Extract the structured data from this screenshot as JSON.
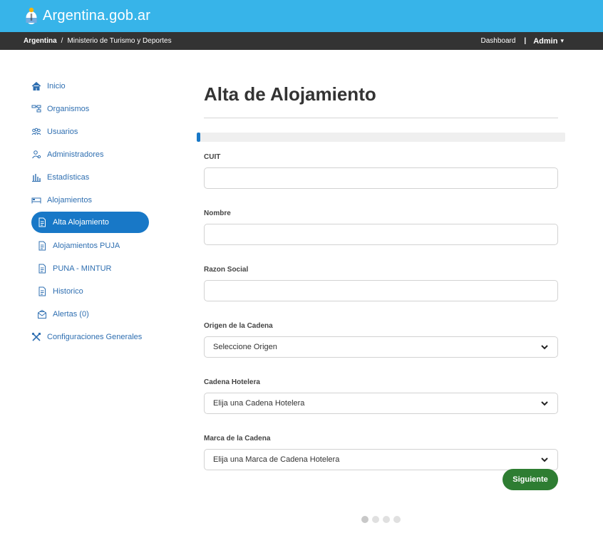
{
  "header": {
    "brand": "Argentina.gob.ar",
    "colors": {
      "topbar": "#37b4e9",
      "subbar": "#333333",
      "accent": "#1878c7",
      "primary_button": "#2e7d32"
    }
  },
  "breadcrumb": {
    "root": "Argentina",
    "separator": "/",
    "current": "Ministerio de Turismo y Deportes"
  },
  "user_menu": {
    "dashboard": "Dashboard",
    "separator": "|",
    "admin": "Admin",
    "caret": "▾"
  },
  "sidebar": {
    "items": [
      {
        "label": "Inicio",
        "icon": "home-icon"
      },
      {
        "label": "Organismos",
        "icon": "org-chart-icon"
      },
      {
        "label": "Usuarios",
        "icon": "users-icon"
      },
      {
        "label": "Administradores",
        "icon": "admin-user-icon"
      },
      {
        "label": "Estadísticas",
        "icon": "bar-chart-icon"
      },
      {
        "label": "Alojamientos",
        "icon": "bed-icon"
      }
    ],
    "subitems": [
      {
        "label": "Alta Alojamiento",
        "icon": "document-icon",
        "active": true
      },
      {
        "label": "Alojamientos PUJA",
        "icon": "document-icon"
      },
      {
        "label": "PUNA - MINTUR",
        "icon": "document-icon"
      },
      {
        "label": "Historico",
        "icon": "document-icon"
      },
      {
        "label": "Alertas (0)",
        "icon": "alert-mail-icon"
      }
    ],
    "footer_item": {
      "label": "Configuraciones Generales",
      "icon": "tools-icon"
    }
  },
  "form": {
    "title": "Alta de Alojamiento",
    "progress_percent": 1,
    "fields": {
      "cuit": {
        "label": "CUIT",
        "value": ""
      },
      "nombre": {
        "label": "Nombre",
        "value": ""
      },
      "razon_social": {
        "label": "Razon Social",
        "value": ""
      },
      "origen": {
        "label": "Origen de la Cadena",
        "value": "Seleccione Origen"
      },
      "cadena": {
        "label": "Cadena Hotelera",
        "value": "Elija una Cadena Hotelera"
      },
      "marca": {
        "label": "Marca de la Cadena",
        "value": "Elija una Marca de Cadena Hotelera"
      }
    },
    "next_label": "Siguiente"
  },
  "pager": {
    "steps": 4,
    "current": 1
  }
}
